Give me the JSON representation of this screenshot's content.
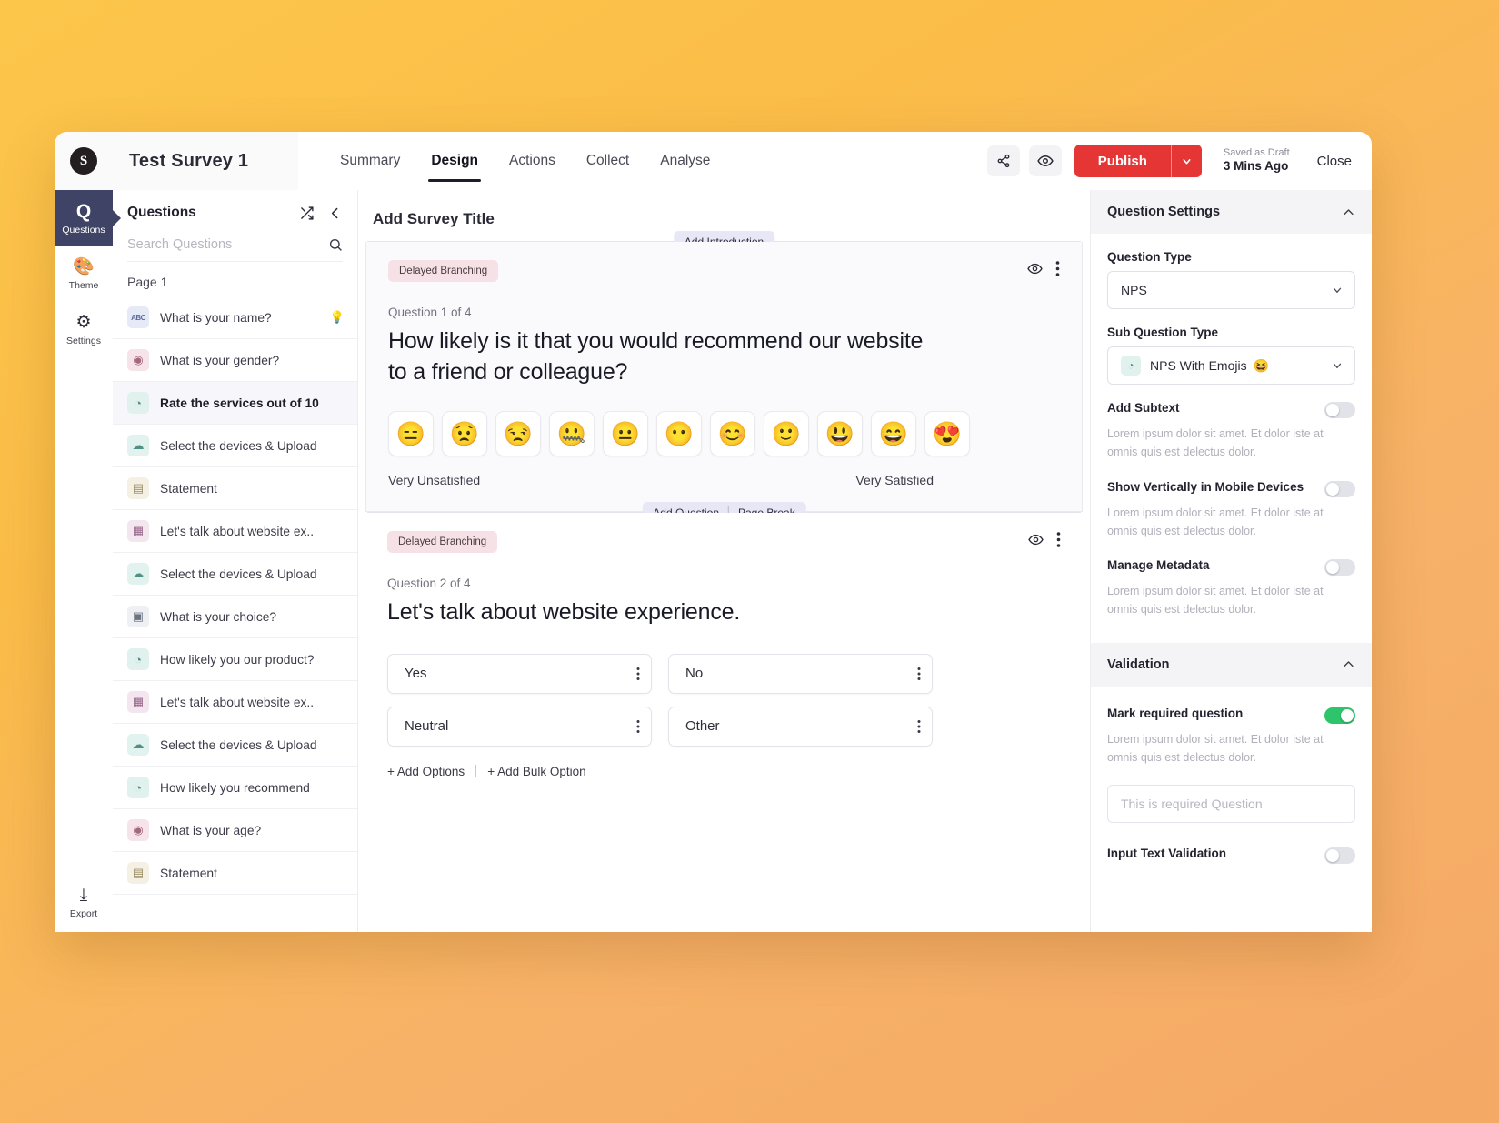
{
  "header": {
    "logo_alt": "app-logo",
    "survey_title": "Test Survey 1",
    "tabs": [
      {
        "label": "Summary",
        "active": false
      },
      {
        "label": "Design",
        "active": true
      },
      {
        "label": "Actions",
        "active": false
      },
      {
        "label": "Collect",
        "active": false
      },
      {
        "label": "Analyse",
        "active": false
      }
    ],
    "share_icon": "share-icon",
    "preview_icon": "eye-icon",
    "publish_label": "Publish",
    "publish_caret_icon": "chevron-down-icon",
    "saved_status": "Saved as Draft",
    "saved_time": "3 Mins Ago",
    "close_label": "Close",
    "publish_color": "#e53535"
  },
  "rail": {
    "items": [
      {
        "glyph": "Q",
        "label": "Questions",
        "icon": "question-icon",
        "active": true
      },
      {
        "glyph": "🎨",
        "label": "Theme",
        "icon": "palette-icon",
        "active": false
      },
      {
        "glyph": "⚙",
        "label": "Settings",
        "icon": "gear-icon",
        "active": false
      }
    ],
    "bottom": {
      "glyph": "⤓",
      "label": "Export",
      "icon": "download-icon"
    }
  },
  "questions_panel": {
    "title": "Questions",
    "shuffle_icon": "shuffle-icon",
    "collapse_icon": "chevron-left-icon",
    "search_placeholder": "Search Questions",
    "search_value": "",
    "search_icon": "search-icon",
    "page_label": "Page 1",
    "items": [
      {
        "label": "What is your name?",
        "icon": "text-field-icon",
        "type": "text",
        "selected": false,
        "badge": "💡"
      },
      {
        "label": "What is your gender?",
        "icon": "radio-button-icon",
        "type": "radio",
        "selected": false,
        "badge": ""
      },
      {
        "label": "Rate the services out of 10",
        "icon": "nps-gauge-icon",
        "type": "nps",
        "selected": true,
        "badge": ""
      },
      {
        "label": "Select the devices & Upload",
        "icon": "cloud-upload-icon",
        "type": "upload",
        "selected": false,
        "badge": ""
      },
      {
        "label": "Statement",
        "icon": "statement-icon",
        "type": "statement",
        "selected": false,
        "badge": ""
      },
      {
        "label": "Let's talk about website ex..",
        "icon": "matrix-grid-icon",
        "type": "matrix",
        "selected": false,
        "badge": ""
      },
      {
        "label": "Select the devices & Upload",
        "icon": "cloud-upload-icon",
        "type": "upload",
        "selected": false,
        "badge": ""
      },
      {
        "label": "What is your choice?",
        "icon": "choice-grid-icon",
        "type": "choice",
        "selected": false,
        "badge": ""
      },
      {
        "label": "How likely you our product?",
        "icon": "nps-gauge-icon",
        "type": "nps",
        "selected": false,
        "badge": ""
      },
      {
        "label": "Let's talk about website ex..",
        "icon": "matrix-grid-icon",
        "type": "matrix",
        "selected": false,
        "badge": ""
      },
      {
        "label": "Select the devices & Upload",
        "icon": "cloud-upload-icon",
        "type": "upload",
        "selected": false,
        "badge": ""
      },
      {
        "label": "How likely you recommend",
        "icon": "nps-gauge-icon",
        "type": "nps",
        "selected": false,
        "badge": ""
      },
      {
        "label": "What is your age?",
        "icon": "radio-button-icon",
        "type": "radio",
        "selected": false,
        "badge": ""
      },
      {
        "label": "Statement",
        "icon": "statement-icon",
        "type": "statement",
        "selected": false,
        "badge": ""
      }
    ]
  },
  "canvas": {
    "add_survey_title": "Add Survey Title",
    "intro_chip": "Add Introduction",
    "add_question_chip": "Add Question",
    "page_break_chip": "Page Break",
    "question1": {
      "branch_badge": "Delayed Branching",
      "eye_icon": "eye-icon",
      "menu_icon": "kebab-menu-icon",
      "counter": "Question 1 of 4",
      "heading": "How likely is it that you would recommend our website to a friend or colleague?",
      "emojis": [
        "😑",
        "😟",
        "😒",
        "🤐",
        "😐",
        "😶",
        "😊",
        "🙂",
        "😃",
        "😄",
        "😍"
      ],
      "label_left": "Very Unsatisfied",
      "label_right": "Very Satisfied"
    },
    "question2": {
      "branch_badge": "Delayed Branching",
      "eye_icon": "eye-icon",
      "menu_icon": "kebab-menu-icon",
      "counter": "Question 2 of 4",
      "heading": "Let's talk about website experience.",
      "options": [
        "Yes",
        "No",
        "Neutral",
        "Other"
      ],
      "option_menu_icon": "kebab-menu-icon",
      "add_options_label": "+ Add Options",
      "add_bulk_label": "+ Add Bulk Option"
    }
  },
  "settings": {
    "question_settings": {
      "title": "Question Settings",
      "collapse_icon": "chevron-up-icon",
      "question_type_label": "Question Type",
      "question_type_value": "NPS",
      "sub_question_type_label": "Sub Question Type",
      "sub_question_type_value": "NPS With Emojis",
      "sub_question_type_emoji": "😆",
      "sub_question_icon": "nps-gauge-icon",
      "toggles": [
        {
          "title": "Add Subtext",
          "desc": "Lorem ipsum dolor sit amet. Et dolor iste at omnis quis est delectus dolor.",
          "on": false
        },
        {
          "title": "Show Vertically in Mobile Devices",
          "desc": "Lorem ipsum dolor sit amet. Et dolor iste at omnis quis est delectus dolor.",
          "on": false
        },
        {
          "title": "Manage Metadata",
          "desc": "Lorem ipsum dolor sit amet. Et dolor iste at omnis quis est delectus dolor.",
          "on": false
        }
      ]
    },
    "validation": {
      "title": "Validation",
      "collapse_icon": "chevron-up-icon",
      "required_title": "Mark required question",
      "required_desc": "Lorem ipsum dolor sit amet. Et dolor iste at omnis quis est delectus dolor.",
      "required_on": true,
      "required_placeholder": "This is required Question",
      "required_value": "",
      "input_validation_title": "Input Text Validation",
      "input_validation_on": false,
      "accent_on_color": "#2ec46b"
    }
  }
}
